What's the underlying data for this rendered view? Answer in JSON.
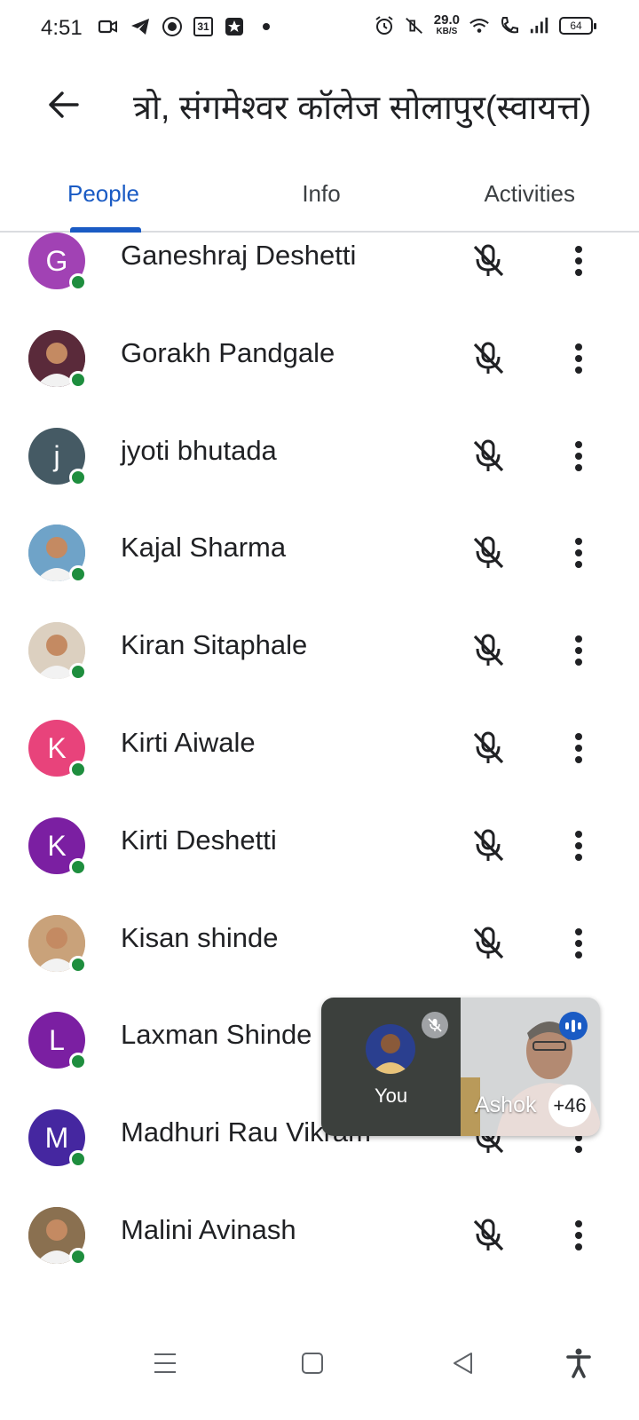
{
  "status_bar": {
    "time": "4:51",
    "net_speed": "29.0",
    "net_speed_unit": "KB/S",
    "battery": "64",
    "calendar_day": "31"
  },
  "header": {
    "title": "त्रो, संगमेश्वर कॉलेज सोलापुर(स्वायत्त)"
  },
  "tabs": [
    {
      "label": "People",
      "active": true
    },
    {
      "label": "Info",
      "active": false
    },
    {
      "label": "Activities",
      "active": false
    }
  ],
  "participants": [
    {
      "name": "Ganeshraj Deshetti",
      "initial": "G",
      "avatar_color": "#a142b4",
      "photo": false
    },
    {
      "name": "Gorakh Pandgale",
      "initial": "",
      "avatar_color": "#5a2a3a",
      "photo": true
    },
    {
      "name": "jyoti bhutada",
      "initial": "j",
      "avatar_color": "#455a64",
      "photo": false
    },
    {
      "name": "Kajal Sharma",
      "initial": "",
      "avatar_color": "#6fa3c8",
      "photo": true
    },
    {
      "name": "Kiran Sitaphale",
      "initial": "",
      "avatar_color": "#dcd0c0",
      "photo": true
    },
    {
      "name": "Kirti Aiwale",
      "initial": "K",
      "avatar_color": "#e8437b",
      "photo": false
    },
    {
      "name": "Kirti Deshetti",
      "initial": "K",
      "avatar_color": "#7b1fa2",
      "photo": false
    },
    {
      "name": "Kisan shinde",
      "initial": "",
      "avatar_color": "#c9a27a",
      "photo": true
    },
    {
      "name": "Laxman Shinde",
      "initial": "L",
      "avatar_color": "#7b1fa2",
      "photo": false
    },
    {
      "name": "Madhuri Rau Vikram",
      "initial": "M",
      "avatar_color": "#4527a0",
      "photo": false
    },
    {
      "name": "Malini Avinash",
      "initial": "",
      "avatar_color": "#8a7050",
      "photo": true
    }
  ],
  "call_preview": {
    "you_label": "You",
    "other_name": "Ashok",
    "more_count": "+46"
  },
  "colors": {
    "accent": "#1a5bc4",
    "online": "#1e8e3e"
  }
}
